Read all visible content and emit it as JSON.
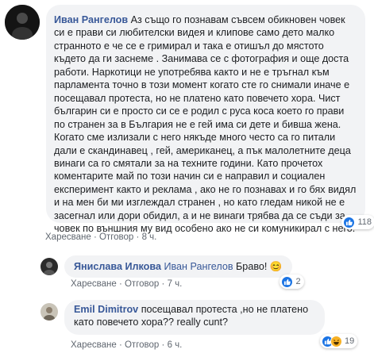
{
  "comments": [
    {
      "author": "Иван Рангелов",
      "text": "Аз също го познавам съвсем обикновен човек си е прави си любителски видея и клипове само дето малко странното е че се е гримирал и така е отишъл до мястото където да ги заснеме . Занимава се с фотография и още доста работи. Наркотици не употребява както и не е тръгнал към парламента точно в този момент когато сте го снимали иначе е посещавал протеста, но не платено като повечето хора. Чист българин си е просто си се е родил с руса коса което го прави по странен за в България не е гей има си дете и бивша жена. Когато сме излизали с него някъде много често са го питали дали е скандинавец , гей, американец, а пък малолетните деца винаги са го смятали за на техните години. Като прочетох коментарите май по този начин си е направил и социален експеримент както и реклама , ако не го познавах и го бях видял и на мен би ми изглеждал странен , но като гледам никой не е засегнал или дори обидил, а и не винаги трябва да се съди за човек по външния му вид особено ако не си комуникирал с него.",
      "actions": {
        "like": "Харесване",
        "sep": "·",
        "reply": "Отговор",
        "time": "8 ч."
      },
      "reactions": {
        "icons": [
          "like-icon"
        ],
        "count": "118"
      }
    },
    {
      "author": "Янислава Илкова",
      "mention": "Иван Рангелов",
      "text": "Браво!",
      "emoji": "😊",
      "actions": {
        "like": "Харесване",
        "sep": "·",
        "reply": "Отговор",
        "time": "7 ч."
      },
      "reactions": {
        "icons": [
          "like-icon"
        ],
        "count": "2"
      }
    },
    {
      "author": "Emil Dimitrov",
      "text": "посещавал протеста ,но не платено като повечето хора?? really cunt?",
      "actions": {
        "like": "Харесване",
        "sep": "·",
        "reply": "Отговор",
        "time": "6 ч."
      },
      "reactions": {
        "icons": [
          "like-icon",
          "haha-icon"
        ],
        "count": "19"
      }
    }
  ],
  "colors": {
    "author": "#385898",
    "bubble": "#f2f3f5",
    "like": "#1b74e4",
    "haha": "#f7b125"
  }
}
